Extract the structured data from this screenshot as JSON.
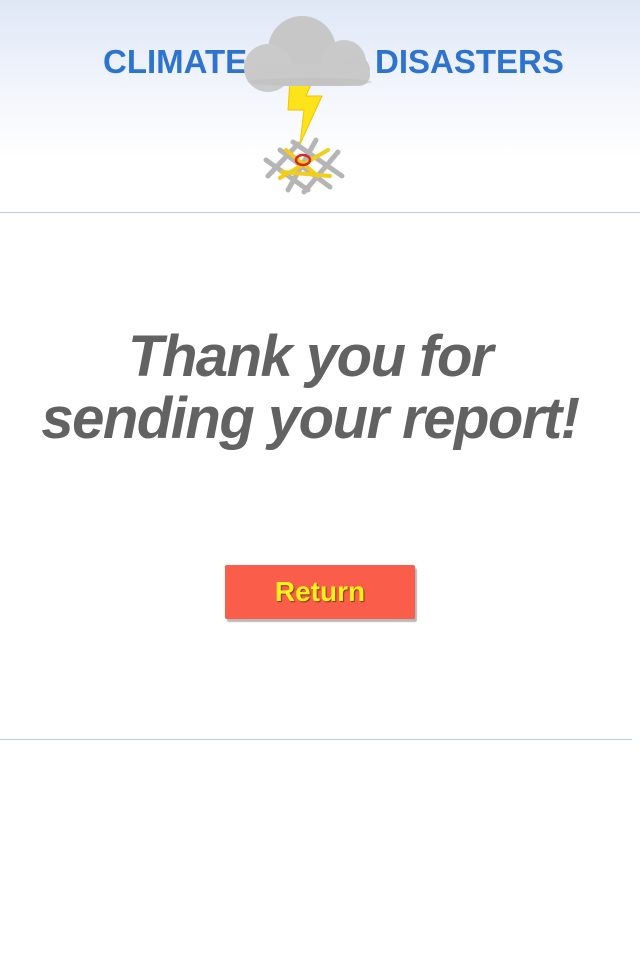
{
  "header": {
    "title_left": "CLIMATE",
    "title_right": "DISASTERS",
    "logo": "cloud-lightning-map-logo"
  },
  "main": {
    "message_line1": "Thank you for",
    "message_line2": "sending your report!",
    "return_label": "Return"
  },
  "colors": {
    "title": "#2e74cf",
    "message": "#626262",
    "button_bg": "#fb5d4b",
    "button_text": "#fff01c",
    "divider": "#b9cde3"
  }
}
